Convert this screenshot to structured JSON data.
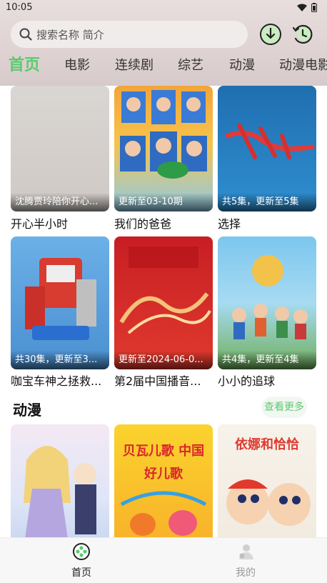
{
  "status_bar": {
    "time": "10:05"
  },
  "search": {
    "placeholder": "搜索名称 简介"
  },
  "tabs": [
    {
      "label": "首页",
      "active": true
    },
    {
      "label": "电影"
    },
    {
      "label": "连续剧"
    },
    {
      "label": "综艺"
    },
    {
      "label": "动漫"
    },
    {
      "label": "动漫电影"
    }
  ],
  "rows": [
    [
      {
        "badge": "沈腾贾玲陪你开心...",
        "title": "开心半小时"
      },
      {
        "badge": "更新至03-10期",
        "title": "我们的爸爸"
      },
      {
        "badge": "共5集，更新至5集",
        "title": "选择"
      }
    ],
    [
      {
        "badge": "共30集，更新至3...",
        "title": "咖宝车神之拯救..."
      },
      {
        "badge": "更新至2024-06-0...",
        "title": "第2届中国播音..."
      },
      {
        "badge": "共4集，更新至4集",
        "title": "小小的追球"
      }
    ]
  ],
  "section": {
    "title": "动漫",
    "more_label": "查看更多"
  },
  "anime_posters": [
    {
      "poster_text": ""
    },
    {
      "poster_text": "贝瓦儿歌 中国好儿歌"
    },
    {
      "poster_text": "依娜和恰恰"
    }
  ],
  "bottom_nav": [
    {
      "label": "首页",
      "active": true
    },
    {
      "label": "我的",
      "active": false
    }
  ],
  "colors": {
    "accent": "#5ccb6f"
  }
}
